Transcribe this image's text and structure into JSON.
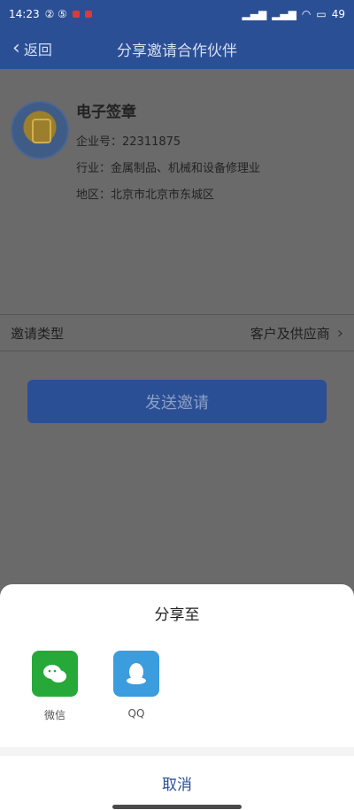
{
  "status_bar": {
    "time": "14:23",
    "left_indicators": "② ⑤",
    "right_text": "49"
  },
  "nav": {
    "back_label": "返回",
    "title": "分享邀请合作伙伴"
  },
  "company": {
    "name": "电子签章",
    "enterprise_number": "企业号：22311875",
    "industry": "行业：金属制品、机械和设备修理业",
    "region": "地区：北京市北京市东城区"
  },
  "invite": {
    "label": "邀请类型",
    "value": "客户及供应商"
  },
  "actions": {
    "send_label": "发送邀请"
  },
  "share_sheet": {
    "title": "分享至",
    "items": [
      {
        "label": "微信",
        "icon": "wechat-icon"
      },
      {
        "label": "QQ",
        "icon": "qq-icon"
      }
    ],
    "cancel_label": "取消"
  },
  "colors": {
    "brand_blue": "#2a4f95",
    "wechat_green": "#26a939",
    "qq_blue": "#3b9cde"
  }
}
